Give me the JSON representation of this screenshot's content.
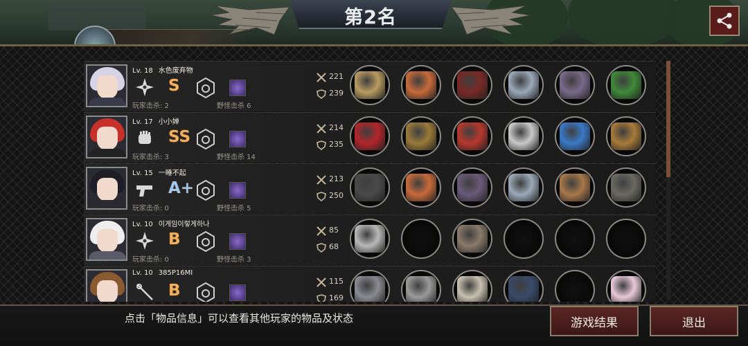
{
  "title": "第2名",
  "header": {
    "share_icon": "share-icon"
  },
  "players": [
    {
      "level": "Lv. 18",
      "name": "水色废弃物",
      "weapon_icon": "shuriken-icon",
      "grade": "S",
      "grade_color": "#f0b060",
      "kills_label": "玩家击杀: 2",
      "monster_label": "野怪击杀 6",
      "atk": "221",
      "def": "239",
      "items": [
        "shield",
        "tiara",
        "armor-red",
        "blade-arm",
        "boots",
        "dragon"
      ],
      "hair": "#d7d3e6",
      "body": "#3a3a4a"
    },
    {
      "level": "Lv. 17",
      "name": "小小婵",
      "weapon_icon": "glove-icon",
      "grade": "SS",
      "grade_color": "#f0b060",
      "kills_label": "玩家击杀: 3",
      "monster_label": "野怪击杀 14",
      "atk": "214",
      "def": "235",
      "items": [
        "claw-red",
        "helmet-gold",
        "shirt-red",
        "disc",
        "shoes-blue",
        "box"
      ],
      "hair": "#c8302a",
      "body": "#222"
    },
    {
      "level": "Lv. 15",
      "name": "一睡不起",
      "weapon_icon": "pistol-icon",
      "grade": "A+",
      "grade_color": "#9ec8f0",
      "kills_label": "玩家击杀: 0",
      "monster_label": "野怪击杀 5",
      "atk": "213",
      "def": "250",
      "items": [
        "rifle",
        "tiara",
        "armor-purple",
        "blade-arm",
        "bracer",
        "backpack"
      ],
      "hair": "#1e1e28",
      "body": "#2a2a30"
    },
    {
      "level": "Lv. 10",
      "name": "이게임이렇게하나",
      "weapon_icon": "shuriken-icon",
      "grade": "B",
      "grade_color": "#f0b060",
      "kills_label": "玩家击杀: 0",
      "monster_label": "野怪击杀 3",
      "atk": "85",
      "def": "68",
      "items": [
        "shuriken",
        "",
        "armor-gray",
        "",
        "",
        ""
      ],
      "hair": "#eeeeee",
      "body": "#5a5a6a"
    },
    {
      "level": "Lv. 10",
      "name": "385P16MI",
      "weapon_icon": "rapier-icon",
      "grade": "B",
      "grade_color": "#f0b060",
      "kills_label": "",
      "monster_label": "",
      "atk": "115",
      "def": "169",
      "items": [
        "knife",
        "helmet-steel",
        "armor-white",
        "watch",
        "",
        "pearl"
      ],
      "hair": "#8a5a30",
      "body": "#3a5a7a"
    }
  ],
  "footer": {
    "hint": "点击「物品信息」可以查看其他玩家的物品及状态",
    "result_button": "游戏结果",
    "exit_button": "退出"
  }
}
